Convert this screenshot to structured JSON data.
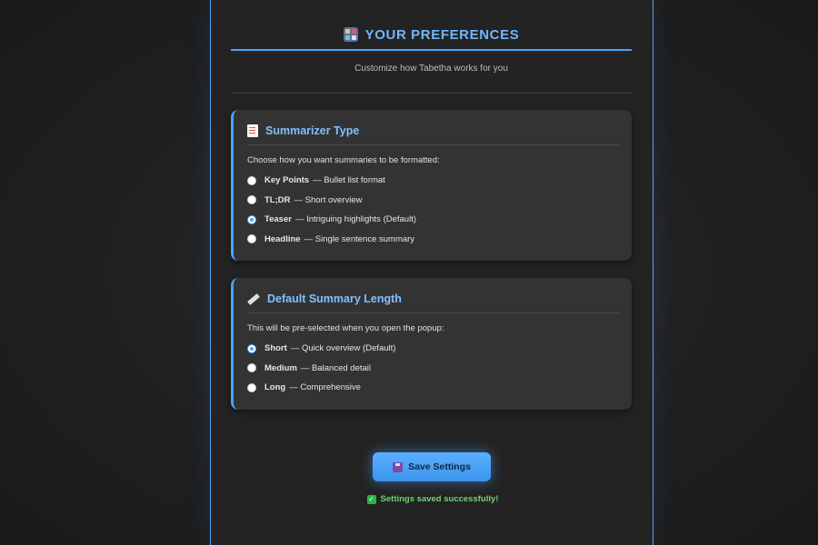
{
  "header": {
    "title": "YOUR PREFERENCES",
    "subtitle": "Customize how Tabetha works for you"
  },
  "summarizer": {
    "title": "Summarizer Type",
    "icon": "document-icon",
    "description": "Choose how you want summaries to be formatted:",
    "options": [
      {
        "label": "Key Points",
        "detail": "— Bullet list format",
        "selected": false
      },
      {
        "label": "TL;DR",
        "detail": "— Short overview",
        "selected": false
      },
      {
        "label": "Teaser",
        "detail": "— Intriguing highlights (Default)",
        "selected": true
      },
      {
        "label": "Headline",
        "detail": "— Single sentence summary",
        "selected": false
      }
    ]
  },
  "length": {
    "title": "Default Summary Length",
    "icon": "ruler-icon",
    "description": "This will be pre-selected when you open the popup:",
    "options": [
      {
        "label": "Short",
        "detail": "— Quick overview (Default)",
        "selected": true
      },
      {
        "label": "Medium",
        "detail": "— Balanced detail",
        "selected": false
      },
      {
        "label": "Long",
        "detail": "— Comprehensive",
        "selected": false
      }
    ]
  },
  "actions": {
    "save_label": "Save Settings",
    "status_message": "Settings saved successfully!"
  },
  "colors": {
    "accent": "#4aa3ff",
    "success": "#6fd36f",
    "background": "#232323",
    "card": "#333333"
  }
}
